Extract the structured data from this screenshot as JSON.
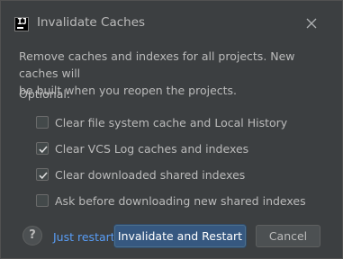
{
  "window": {
    "title": "Invalidate Caches"
  },
  "message": {
    "line1": "Remove caches and indexes for all projects. New caches will",
    "line2": "be built when you reopen the projects."
  },
  "optional_label": "Optional:",
  "options": [
    {
      "label": "Clear file system cache and Local History",
      "checked": false
    },
    {
      "label": "Clear VCS Log caches and indexes",
      "checked": true
    },
    {
      "label": "Clear downloaded shared indexes",
      "checked": true
    },
    {
      "label": "Ask before downloading new shared indexes",
      "checked": false
    }
  ],
  "footer": {
    "help_label": "?",
    "link_label": "Just restart",
    "primary_label": "Invalidate and Restart",
    "secondary_label": "Cancel"
  },
  "colors": {
    "background": "#3c3f41",
    "text": "#bbbbbb",
    "link": "#589df6",
    "primary_button": "#365880"
  },
  "icons": {
    "app": "intellij-app-icon",
    "close": "close-icon",
    "check": "checkmark-icon"
  }
}
